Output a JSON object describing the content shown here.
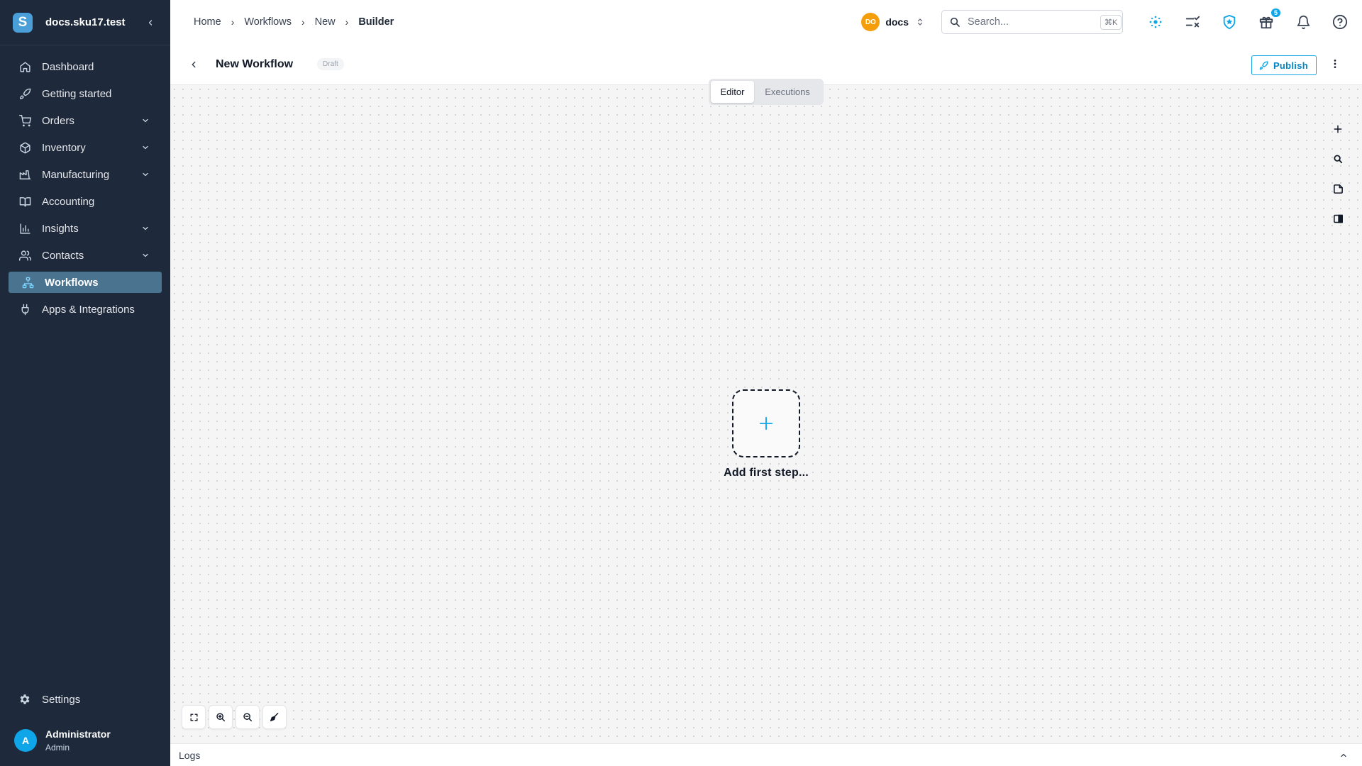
{
  "sidebar": {
    "org_name": "docs.sku17.test",
    "logo_letter": "S",
    "items": [
      {
        "label": "Dashboard",
        "icon": "home-icon"
      },
      {
        "label": "Getting started",
        "icon": "rocket-icon"
      },
      {
        "label": "Orders",
        "icon": "cart-icon",
        "expandable": true
      },
      {
        "label": "Inventory",
        "icon": "box-icon",
        "expandable": true
      },
      {
        "label": "Manufacturing",
        "icon": "factory-icon",
        "expandable": true
      },
      {
        "label": "Accounting",
        "icon": "book-icon"
      },
      {
        "label": "Insights",
        "icon": "bar-chart-icon",
        "expandable": true
      },
      {
        "label": "Contacts",
        "icon": "users-icon",
        "expandable": true
      },
      {
        "label": "Workflows",
        "icon": "workflow-icon",
        "active": true
      },
      {
        "label": "Apps & Integrations",
        "icon": "plug-icon"
      }
    ],
    "settings_label": "Settings",
    "user": {
      "initial": "A",
      "name": "Administrator",
      "role": "Admin"
    }
  },
  "topbar": {
    "breadcrumbs": [
      "Home",
      "Workflows",
      "New",
      "Builder"
    ],
    "breadcrumb_separator": "›",
    "workspace": {
      "badge": "DO",
      "name": "docs"
    },
    "search": {
      "placeholder": "Search...",
      "shortcut": "⌘K"
    },
    "gift_badge_count": "5"
  },
  "workflow": {
    "title": "New Workflow",
    "status": "Draft",
    "publish_label": "Publish",
    "tabs": [
      {
        "label": "Editor",
        "active": true
      },
      {
        "label": "Executions",
        "active": false
      }
    ],
    "add_step_label": "Add first step..."
  },
  "logs": {
    "label": "Logs"
  },
  "colors": {
    "sidebar_bg": "#1e293b",
    "active_nav_bg": "#4a7390",
    "accent": "#0ea5e9",
    "workspace_badge": "#f59e0b"
  }
}
